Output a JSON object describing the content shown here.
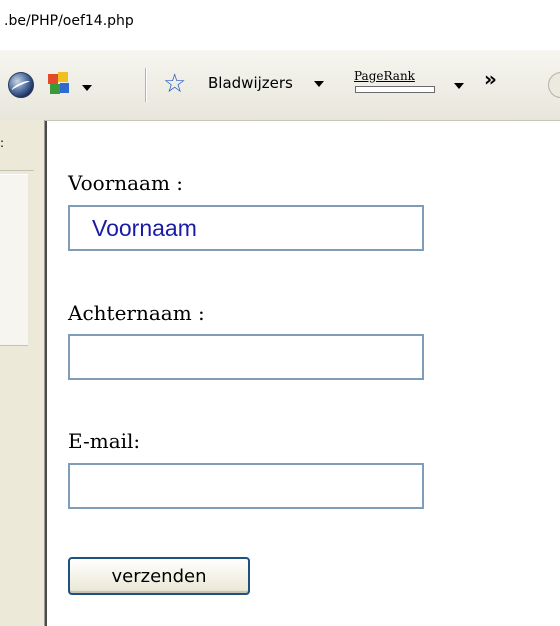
{
  "browser": {
    "url_text": ".be/PHP/oef14.php",
    "toolbar": {
      "bookmarks_label": "Bladwijzers",
      "pagerank_label": "PageRank",
      "overflow_label": "»"
    }
  },
  "sidebar": {
    "tick_label": ":"
  },
  "form": {
    "voornaam": {
      "label": "Voornaam :",
      "value": "Voornaam"
    },
    "achternaam": {
      "label": "Achternaam :",
      "value": ""
    },
    "email": {
      "label": "E-mail:",
      "value": ""
    },
    "submit_label": "verzenden"
  }
}
